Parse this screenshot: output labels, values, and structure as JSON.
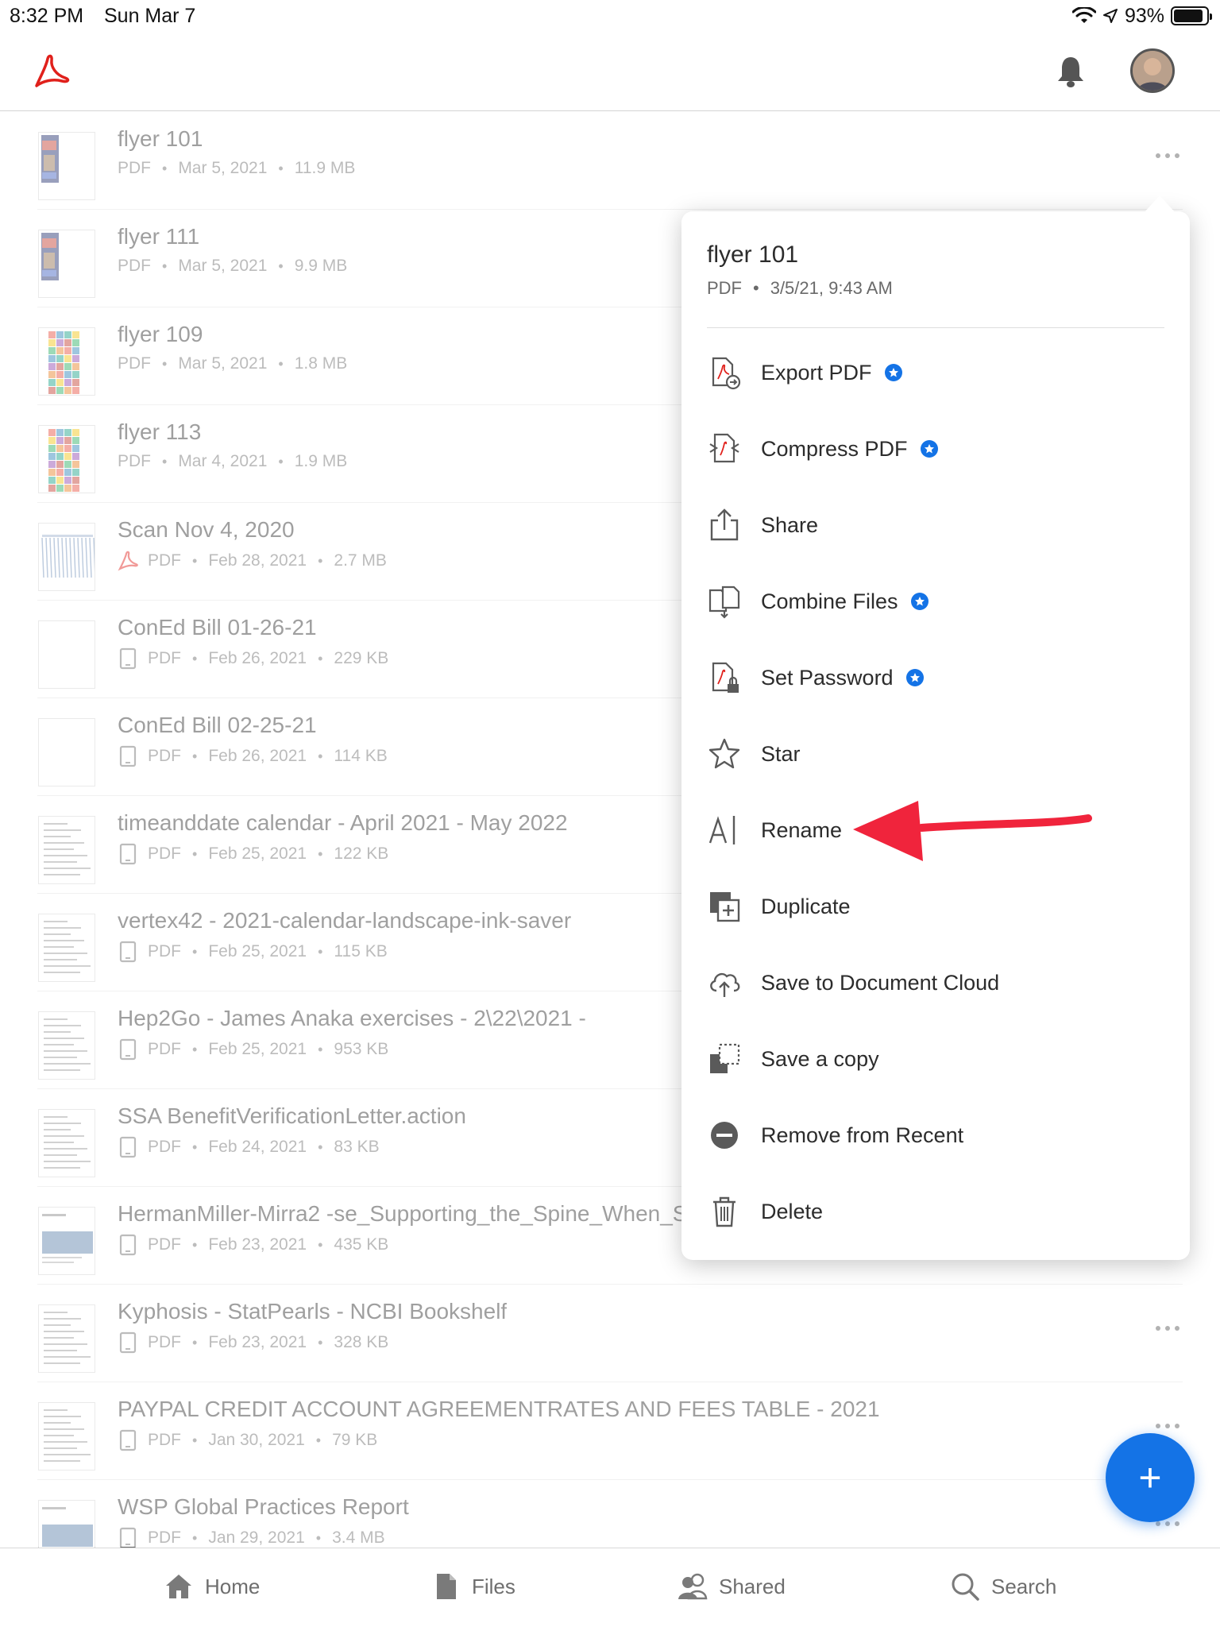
{
  "status_bar": {
    "time": "8:32 PM",
    "date": "Sun Mar 7",
    "battery": "93%"
  },
  "files": [
    {
      "title": "flyer 101",
      "type": "PDF",
      "date": "Mar 5, 2021",
      "size": "11.9 MB",
      "source": "none",
      "thumb": "flyer-dark"
    },
    {
      "title": "flyer 111",
      "type": "PDF",
      "date": "Mar 5, 2021",
      "size": "9.9 MB",
      "source": "none",
      "thumb": "flyer-dark"
    },
    {
      "title": "flyer 109",
      "type": "PDF",
      "date": "Mar 5, 2021",
      "size": "1.8 MB",
      "source": "none",
      "thumb": "flyer-color"
    },
    {
      "title": "flyer 113",
      "type": "PDF",
      "date": "Mar 4, 2021",
      "size": "1.9 MB",
      "source": "none",
      "thumb": "flyer-color"
    },
    {
      "title": "Scan Nov 4, 2020",
      "type": "PDF",
      "date": "Feb 28, 2021",
      "size": "2.7 MB",
      "source": "acrobat",
      "thumb": "scan"
    },
    {
      "title": "ConEd Bill 01-26-21",
      "type": "PDF",
      "date": "Feb 26, 2021",
      "size": "229 KB",
      "source": "device",
      "thumb": "blank"
    },
    {
      "title": "ConEd Bill 02-25-21",
      "type": "PDF",
      "date": "Feb 26, 2021",
      "size": "114 KB",
      "source": "device",
      "thumb": "blank"
    },
    {
      "title": "timeanddate calendar - April 2021 - May 2022",
      "type": "PDF",
      "date": "Feb 25, 2021",
      "size": "122 KB",
      "source": "device",
      "thumb": "doc"
    },
    {
      "title": "vertex42 - 2021-calendar-landscape-ink-saver",
      "type": "PDF",
      "date": "Feb 25, 2021",
      "size": "115 KB",
      "source": "device",
      "thumb": "doc"
    },
    {
      "title": "Hep2Go - James Anaka exercises - 2\\22\\2021 -",
      "type": "PDF",
      "date": "Feb 25, 2021",
      "size": "953 KB",
      "source": "device",
      "thumb": "doc"
    },
    {
      "title": "SSA BenefitVerificationLetter.action",
      "type": "PDF",
      "date": "Feb 24, 2021",
      "size": "83 KB",
      "source": "device",
      "thumb": "doc"
    },
    {
      "title": "HermanMiller-Mirra2 -se_Supporting_the_Spine_When_S",
      "type": "PDF",
      "date": "Feb 23, 2021",
      "size": "435 KB",
      "source": "device",
      "thumb": "photo-doc"
    },
    {
      "title": "Kyphosis - StatPearls - NCBI Bookshelf",
      "type": "PDF",
      "date": "Feb 23, 2021",
      "size": "328 KB",
      "source": "device",
      "thumb": "doc"
    },
    {
      "title": "PAYPAL CREDIT ACCOUNT AGREEMENTRATES AND FEES TABLE - 2021",
      "type": "PDF",
      "date": "Jan 30, 2021",
      "size": "79 KB",
      "source": "device",
      "thumb": "doc"
    },
    {
      "title": "WSP Global Practices Report",
      "type": "PDF",
      "date": "Jan 29, 2021",
      "size": "3.4 MB",
      "source": "device",
      "thumb": "photo-doc"
    }
  ],
  "popover": {
    "title": "flyer 101",
    "type": "PDF",
    "timestamp": "3/5/21, 9:43 AM",
    "items": [
      {
        "label": "Export PDF",
        "icon": "export-pdf-icon",
        "premium": true
      },
      {
        "label": "Compress PDF",
        "icon": "compress-pdf-icon",
        "premium": true
      },
      {
        "label": "Share",
        "icon": "share-icon",
        "premium": false
      },
      {
        "label": "Combine Files",
        "icon": "combine-files-icon",
        "premium": true
      },
      {
        "label": "Set Password",
        "icon": "set-password-icon",
        "premium": true
      },
      {
        "label": "Star",
        "icon": "star-icon",
        "premium": false
      },
      {
        "label": "Rename",
        "icon": "rename-icon",
        "premium": false
      },
      {
        "label": "Duplicate",
        "icon": "duplicate-icon",
        "premium": false
      },
      {
        "label": "Save to Document Cloud",
        "icon": "cloud-upload-icon",
        "premium": false
      },
      {
        "label": "Save a copy",
        "icon": "save-copy-icon",
        "premium": false
      },
      {
        "label": "Remove from Recent",
        "icon": "remove-icon",
        "premium": false
      },
      {
        "label": "Delete",
        "icon": "trash-icon",
        "premium": false
      }
    ]
  },
  "tabs": [
    {
      "label": "Home",
      "icon": "home-icon"
    },
    {
      "label": "Files",
      "icon": "file-icon"
    },
    {
      "label": "Shared",
      "icon": "people-icon"
    },
    {
      "label": "Search",
      "icon": "search-icon"
    }
  ],
  "fab": {
    "label": "+"
  },
  "colors": {
    "accent": "#1473e6",
    "acrobat_red": "#e0201b",
    "annotation_red": "#f0243c"
  }
}
